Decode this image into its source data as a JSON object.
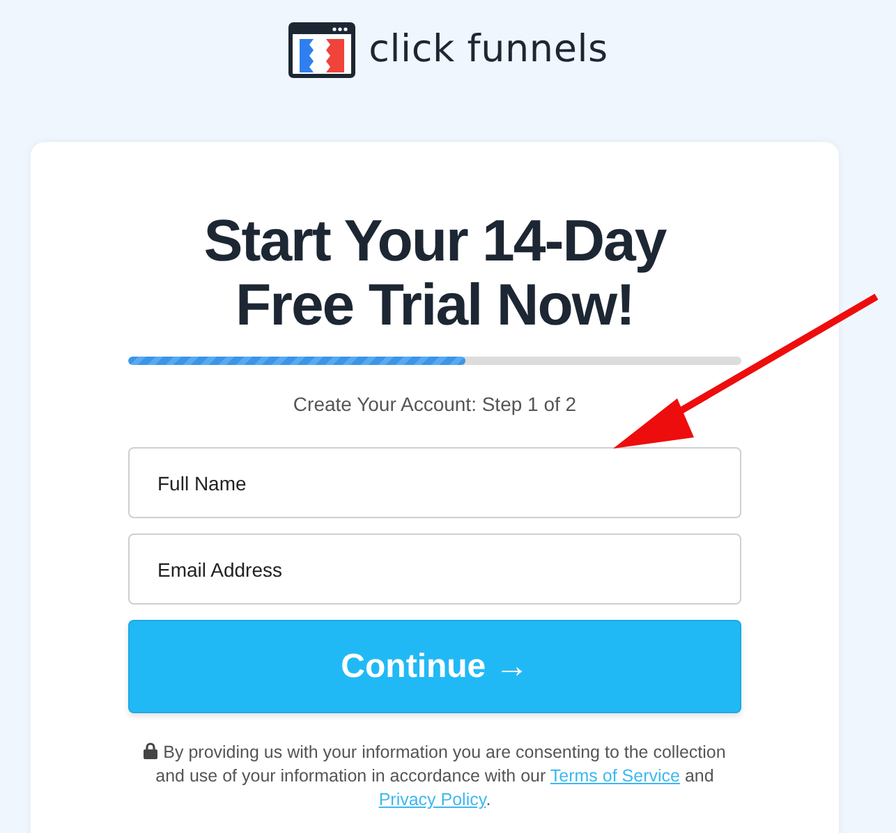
{
  "logo": {
    "text": "click funnels"
  },
  "heading": [
    "Start Your 14-Day",
    "Free Trial Now!"
  ],
  "progress": {
    "level": 0.55
  },
  "step_text": "Create Your Account: Step 1 of 2",
  "fields": [
    {
      "placeholder": "Full Name"
    },
    {
      "placeholder": "Email Address"
    }
  ],
  "continue_button": {
    "label": "Continue",
    "icon": "→"
  },
  "disclaimer": {
    "text_before": "By providing us with your information you are consenting to the collection and use of your information in accordance with our ",
    "terms_link": "Terms of Service",
    "text_middle": " and ",
    "privacy_link": "Privacy Policy",
    "text_after": "."
  }
}
